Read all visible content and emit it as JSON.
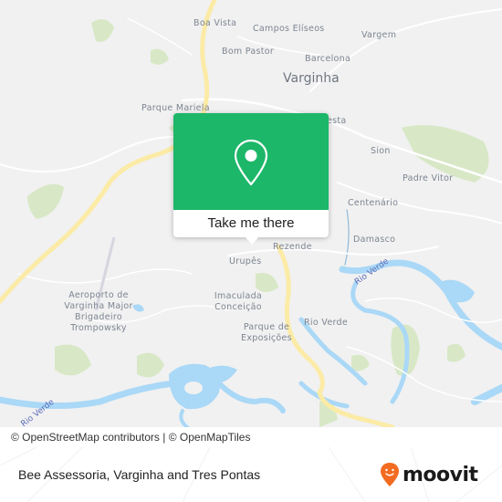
{
  "map": {
    "places": [
      {
        "id": "boa-vista",
        "label": "Boa Vista"
      },
      {
        "id": "campos-eliseos",
        "label": "Campos Elíseos"
      },
      {
        "id": "vargem",
        "label": "Vargem"
      },
      {
        "id": "bom-pastor",
        "label": "Bom Pastor"
      },
      {
        "id": "barcelona",
        "label": "Barcelona"
      },
      {
        "id": "varginha",
        "label": "Varginha"
      },
      {
        "id": "parque-mariela",
        "label": "Parque Mariela"
      },
      {
        "id": "floresta-partial",
        "label": "esta"
      },
      {
        "id": "sion",
        "label": "Sion"
      },
      {
        "id": "padre-vitor",
        "label": "Padre Vitor"
      },
      {
        "id": "centenario",
        "label": "Centenário"
      },
      {
        "id": "damasco",
        "label": "Damasco"
      },
      {
        "id": "rezende",
        "label": "Rezende"
      },
      {
        "id": "urupes",
        "label": "Urupês"
      },
      {
        "id": "imaculada-conceicao",
        "label": "Imaculada Conceição"
      },
      {
        "id": "parque-exposicoes",
        "label": "Parque de Exposições"
      },
      {
        "id": "rio-verde-district",
        "label": "Rio Verde"
      },
      {
        "id": "aeroporto",
        "label": "Aeroporto de Varginha Major Brigadeiro Trompowsky"
      }
    ],
    "rivers": [
      {
        "id": "rio-verde-east",
        "label": "Rio Verde"
      },
      {
        "id": "rio-verde-west",
        "label": "Rio Verde"
      }
    ],
    "colors": {
      "land": "#f1f1f1",
      "water": "#aad8f7",
      "park": "#d8e8c6",
      "highway": "#fbeba6",
      "road": "#ffffff"
    }
  },
  "popup": {
    "button_label": "Take me there",
    "icon": "map-pin-icon",
    "accent": "#1cb769"
  },
  "attribution": {
    "text": "© OpenStreetMap contributors | © OpenMapTiles"
  },
  "footer": {
    "title": "Bee Assessoria, Varginha and Tres Pontas",
    "brand": "moovit",
    "brand_color": "#f26b21"
  }
}
